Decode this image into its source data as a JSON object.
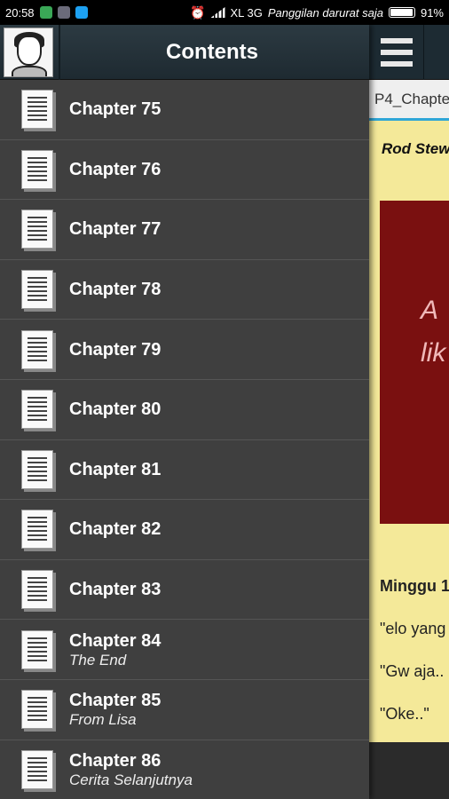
{
  "status_bar": {
    "time": "20:58",
    "network": "XL 3G",
    "carrier_text": "Panggilan darurat saja",
    "battery": "91%"
  },
  "drawer": {
    "title": "Contents",
    "items": [
      {
        "title": "Chapter 75",
        "subtitle": ""
      },
      {
        "title": "Chapter 76",
        "subtitle": ""
      },
      {
        "title": "Chapter 77",
        "subtitle": ""
      },
      {
        "title": "Chapter 78",
        "subtitle": ""
      },
      {
        "title": "Chapter 79",
        "subtitle": ""
      },
      {
        "title": "Chapter 80",
        "subtitle": ""
      },
      {
        "title": "Chapter 81",
        "subtitle": ""
      },
      {
        "title": "Chapter 82",
        "subtitle": ""
      },
      {
        "title": "Chapter 83",
        "subtitle": ""
      },
      {
        "title": "Chapter 84",
        "subtitle": "The End"
      },
      {
        "title": "Chapter 85",
        "subtitle": "From Lisa"
      },
      {
        "title": "Chapter 86",
        "subtitle": "Cerita Selanjutnya"
      }
    ]
  },
  "reader": {
    "tab_label": "P4_Chapte",
    "author_partial": "Rod Stew",
    "image_text_line1": "A",
    "image_text_line2": "lik",
    "lines": [
      "Minggu 1",
      "\"elo yang",
      "\"Gw aja..",
      "\"Oke..\""
    ]
  },
  "colors": {
    "drawer_bg": "#3f3f3f",
    "header_bg": "#1e2a31",
    "page_bg": "#f4e999",
    "accent": "#2fa6d6",
    "image_bg": "#7a1010"
  }
}
